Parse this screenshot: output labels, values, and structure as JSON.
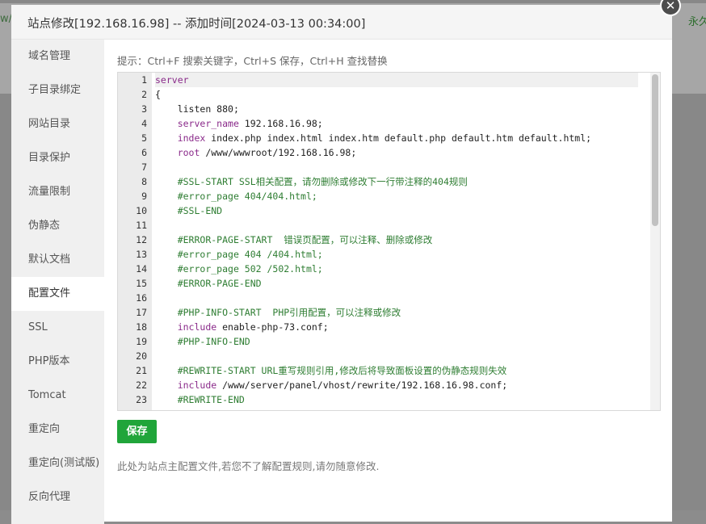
{
  "background": {
    "left_text": "w/",
    "right_text": "永久"
  },
  "modal": {
    "title": "站点修改[192.168.16.98] -- 添加时间[2024-03-13 00:34:00]",
    "close_label": "✕"
  },
  "sidebar": {
    "items": [
      {
        "label": "域名管理",
        "active": false
      },
      {
        "label": "子目录绑定",
        "active": false
      },
      {
        "label": "网站目录",
        "active": false
      },
      {
        "label": "目录保护",
        "active": false
      },
      {
        "label": "流量限制",
        "active": false
      },
      {
        "label": "伪静态",
        "active": false
      },
      {
        "label": "默认文档",
        "active": false
      },
      {
        "label": "配置文件",
        "active": true
      },
      {
        "label": "SSL",
        "active": false
      },
      {
        "label": "PHP版本",
        "active": false
      },
      {
        "label": "Tomcat",
        "active": false
      },
      {
        "label": "重定向",
        "active": false
      },
      {
        "label": "重定向(测试版)",
        "active": false
      },
      {
        "label": "反向代理",
        "active": false
      }
    ]
  },
  "hint": "提示：Ctrl+F 搜索关键字，Ctrl+S 保存，Ctrl+H 查找替换",
  "editor": {
    "lines": [
      {
        "n": "1",
        "indent": "",
        "kw": "server",
        "rest": "",
        "type": "kw"
      },
      {
        "n": "2",
        "indent": "",
        "kw": "",
        "rest": "{",
        "type": "plain"
      },
      {
        "n": "3",
        "indent": "    ",
        "kw": "",
        "rest": "listen 880;",
        "type": "plain"
      },
      {
        "n": "4",
        "indent": "    ",
        "kw": "server_name",
        "rest": " 192.168.16.98;",
        "type": "kw"
      },
      {
        "n": "5",
        "indent": "    ",
        "kw": "index",
        "rest": " index.php index.html index.htm default.php default.htm default.html;",
        "type": "kw"
      },
      {
        "n": "6",
        "indent": "    ",
        "kw": "root",
        "rest": " /www/wwwroot/192.168.16.98;",
        "type": "kw"
      },
      {
        "n": "7",
        "indent": "",
        "kw": "",
        "rest": "",
        "type": "plain"
      },
      {
        "n": "8",
        "indent": "    ",
        "kw": "",
        "rest": "#SSL-START SSL相关配置，请勿删除或修改下一行带注释的404规则",
        "type": "comment"
      },
      {
        "n": "9",
        "indent": "    ",
        "kw": "",
        "rest": "#error_page 404/404.html;",
        "type": "comment"
      },
      {
        "n": "10",
        "indent": "    ",
        "kw": "",
        "rest": "#SSL-END",
        "type": "comment"
      },
      {
        "n": "11",
        "indent": "",
        "kw": "",
        "rest": "",
        "type": "plain"
      },
      {
        "n": "12",
        "indent": "    ",
        "kw": "",
        "rest": "#ERROR-PAGE-START  错误页配置，可以注释、删除或修改",
        "type": "comment"
      },
      {
        "n": "13",
        "indent": "    ",
        "kw": "",
        "rest": "#error_page 404 /404.html;",
        "type": "comment"
      },
      {
        "n": "14",
        "indent": "    ",
        "kw": "",
        "rest": "#error_page 502 /502.html;",
        "type": "comment"
      },
      {
        "n": "15",
        "indent": "    ",
        "kw": "",
        "rest": "#ERROR-PAGE-END",
        "type": "comment"
      },
      {
        "n": "16",
        "indent": "",
        "kw": "",
        "rest": "",
        "type": "plain"
      },
      {
        "n": "17",
        "indent": "    ",
        "kw": "",
        "rest": "#PHP-INFO-START  PHP引用配置，可以注释或修改",
        "type": "comment"
      },
      {
        "n": "18",
        "indent": "    ",
        "kw": "include",
        "rest": " enable-php-73.conf;",
        "type": "kw"
      },
      {
        "n": "19",
        "indent": "    ",
        "kw": "",
        "rest": "#PHP-INFO-END",
        "type": "comment"
      },
      {
        "n": "20",
        "indent": "",
        "kw": "",
        "rest": "",
        "type": "plain"
      },
      {
        "n": "21",
        "indent": "    ",
        "kw": "",
        "rest": "#REWRITE-START URL重写规则引用,修改后将导致面板设置的伪静态规则失效",
        "type": "comment"
      },
      {
        "n": "22",
        "indent": "    ",
        "kw": "include",
        "rest": " /www/server/panel/vhost/rewrite/192.168.16.98.conf;",
        "type": "kw"
      },
      {
        "n": "23",
        "indent": "    ",
        "kw": "",
        "rest": "#REWRITE-END",
        "type": "comment"
      }
    ]
  },
  "save_label": "保存",
  "note": "此处为站点主配置文件,若您不了解配置规则,请勿随意修改."
}
